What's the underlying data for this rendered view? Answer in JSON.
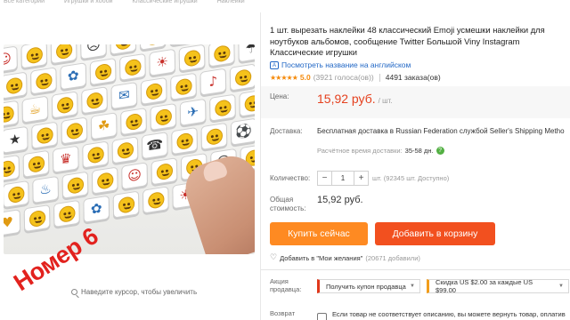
{
  "breadcrumbs": [
    "Все категории",
    "Игрушки и хобби",
    "Классические игрушки",
    "Наклейки"
  ],
  "gallery": {
    "badge_text": "Номер 6",
    "zoom_hint": "Наведите курсор, чтобы увеличить"
  },
  "product": {
    "title": "1 шт. вырезать наклейки 48 классический Emoji усмешки наклейки для ноутбуков альбомов, сообщение Twitter Большой Viny Instagram Классические игрушки",
    "translate_link": "Посмотреть название на английском",
    "rating": {
      "score": "5.0",
      "votes": "(3921 голоса(ов))",
      "orders": "4491 заказа(ов)",
      "stars": "★★★★★"
    },
    "price": {
      "label": "Цена:",
      "value": "15,92 руб.",
      "unit": "/ шт."
    },
    "delivery": {
      "label": "Доставка:",
      "text": "Бесплатная доставка в Russian Federation службой Seller's Shipping Metho",
      "time_label": "Расчётное время доставки:",
      "time_value": "35-58 дн."
    },
    "quantity": {
      "label": "Количество:",
      "value": "1",
      "minus": "−",
      "plus": "+",
      "available": "шт. (92345 шт. Доступно)"
    },
    "total": {
      "label": "Общая стоимость:",
      "value": "15,92 руб."
    },
    "buttons": {
      "buy_now": "Купить сейчас",
      "add_to_cart": "Добавить в корзину"
    },
    "wishlist": {
      "text": "Добавить в \"Мои желания\"",
      "count": "(20671 добавили)"
    },
    "promo": {
      "label": "Акция продавца:",
      "coupon_label": "Получить купон продавца",
      "discount_label": "Скидка US $2.00 за каждые US $99.00"
    },
    "returns": {
      "label": "Возврат товара",
      "text": "Если товар не соответствует описанию, вы можете вернуть товар, оплатив стоимость обратной пересылки, или оставить товар себе и"
    }
  },
  "colors": {
    "accent_orange": "#fe8a22",
    "accent_red": "#f2501f",
    "price_red": "#e5411f",
    "link_blue": "#2469c6"
  }
}
